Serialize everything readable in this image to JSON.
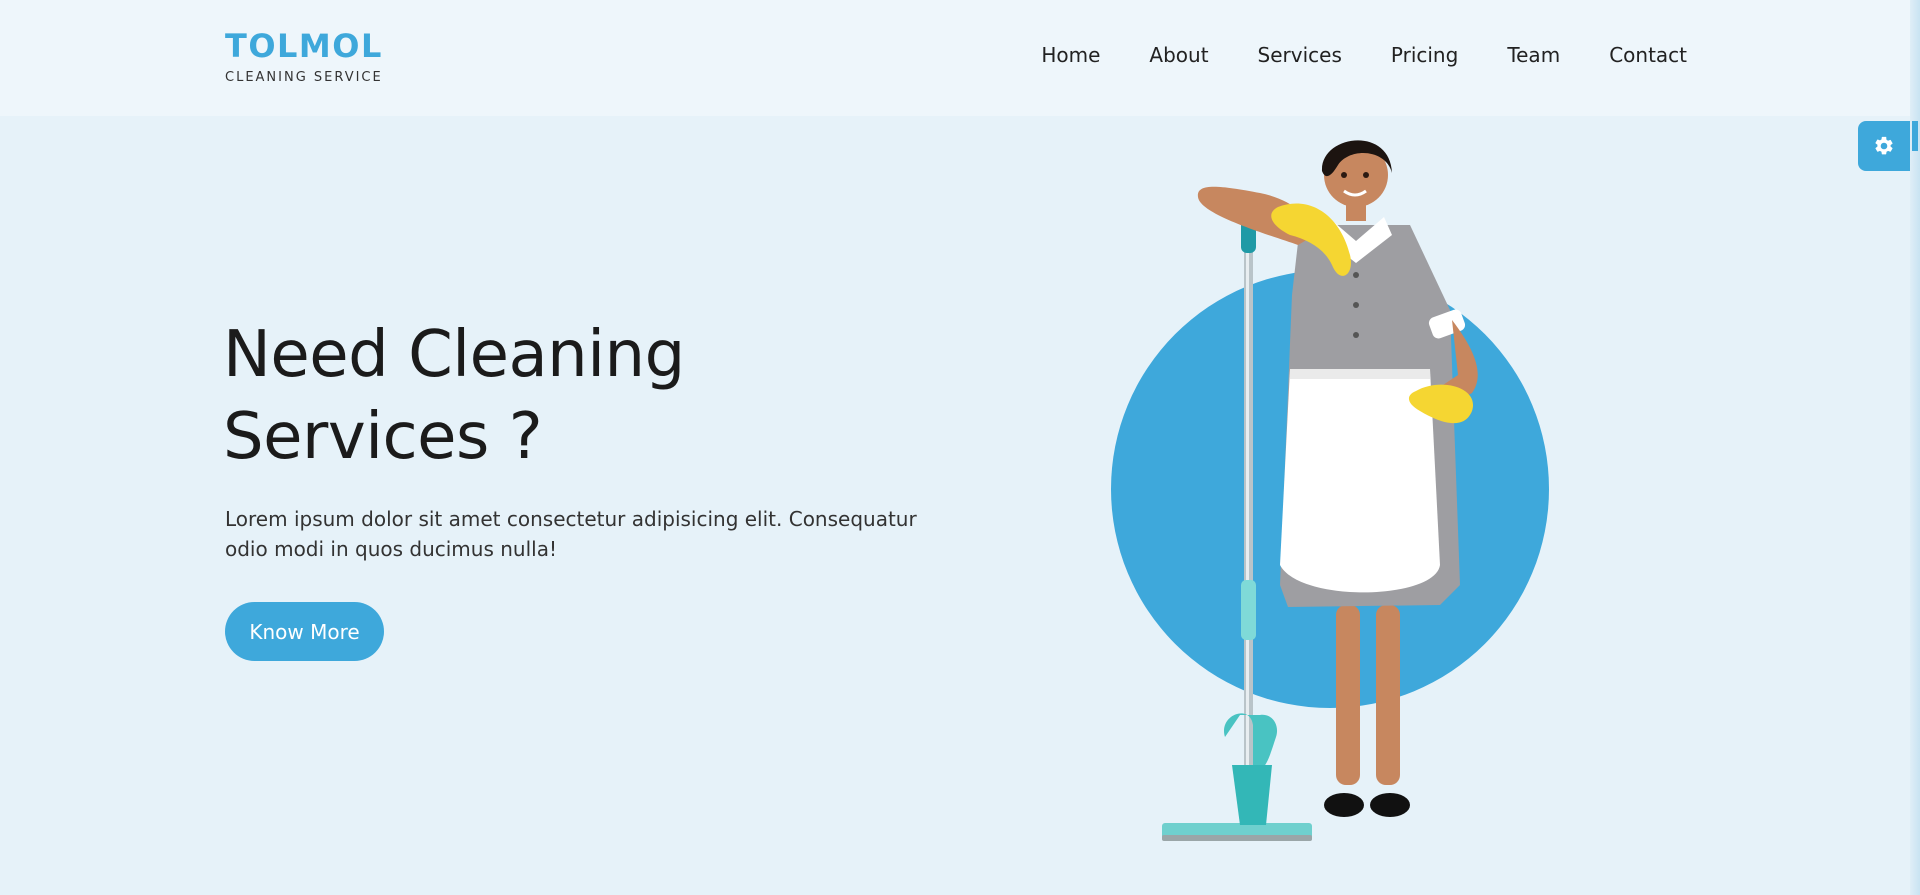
{
  "brand": {
    "name": "TOLMOL",
    "tagline": "CLEANING SERVICE",
    "accent_color": "#3ea8db"
  },
  "nav": {
    "items": [
      {
        "label": "Home"
      },
      {
        "label": "About"
      },
      {
        "label": "Services"
      },
      {
        "label": "Pricing"
      },
      {
        "label": "Team"
      },
      {
        "label": "Contact"
      }
    ]
  },
  "hero": {
    "title_line1": "Need Cleaning",
    "title_line2": "Services ?",
    "text": "Lorem ipsum dolor sit amet consectetur adipisicing elit. Consequatur odio modi in quos ducimus nulla!",
    "cta_label": "Know More",
    "image": "cleaning-woman-with-mop"
  },
  "settings": {
    "icon": "gear-icon"
  }
}
